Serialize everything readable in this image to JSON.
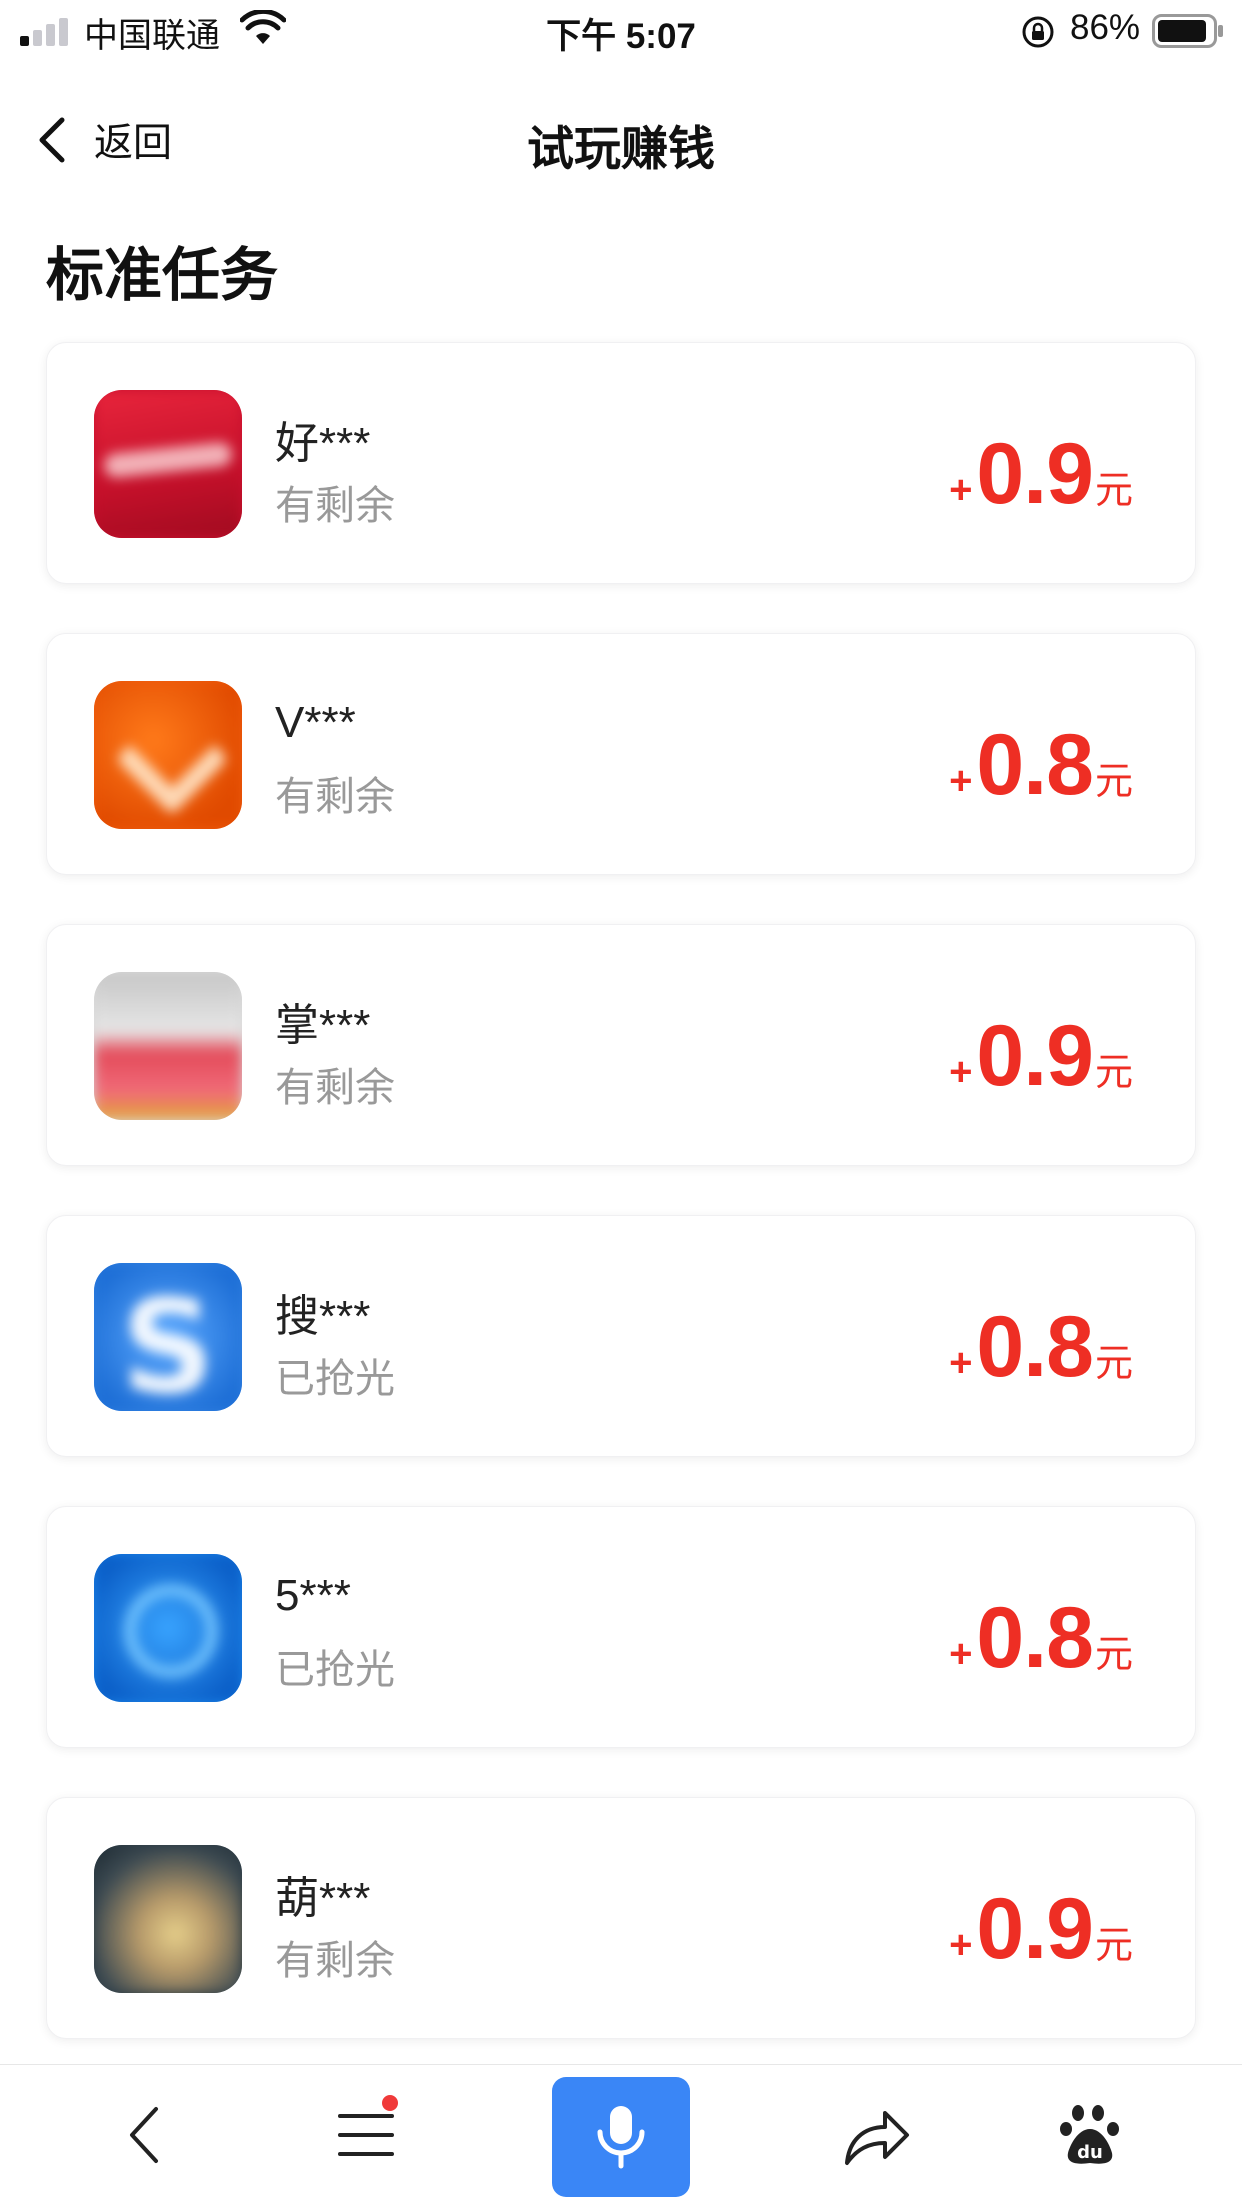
{
  "status_bar": {
    "carrier": "中国联通",
    "time": "下午 5:07",
    "battery_percent": "86%",
    "icons": [
      "signal-icon",
      "wifi-icon",
      "orientation-lock-icon",
      "battery-icon"
    ]
  },
  "nav": {
    "back_label": "返回",
    "title": "试玩赚钱"
  },
  "section": {
    "title": "标准任务"
  },
  "tasks": [
    {
      "name": "好***",
      "status": "有剩余",
      "plus": "+",
      "amount": "0.9",
      "unit": "元"
    },
    {
      "name": "V***",
      "status": "有剩余",
      "plus": "+",
      "amount": "0.8",
      "unit": "元"
    },
    {
      "name": "掌***",
      "status": "有剩余",
      "plus": "+",
      "amount": "0.9",
      "unit": "元"
    },
    {
      "name": "搜***",
      "status": "已抢光",
      "plus": "+",
      "amount": "0.8",
      "unit": "元"
    },
    {
      "name": "5***",
      "status": "已抢光",
      "plus": "+",
      "amount": "0.8",
      "unit": "元"
    },
    {
      "name": "葫***",
      "status": "有剩余",
      "plus": "+",
      "amount": "0.9",
      "unit": "元"
    }
  ],
  "colors": {
    "reward": "#ee2e24",
    "status_text": "#999999",
    "mic_button": "#3a86f6",
    "notification_dot": "#f03a3a"
  },
  "toolbar": {
    "icons": [
      "back-icon",
      "menu-icon",
      "microphone-icon",
      "share-icon",
      "baidu-paw-icon"
    ]
  }
}
